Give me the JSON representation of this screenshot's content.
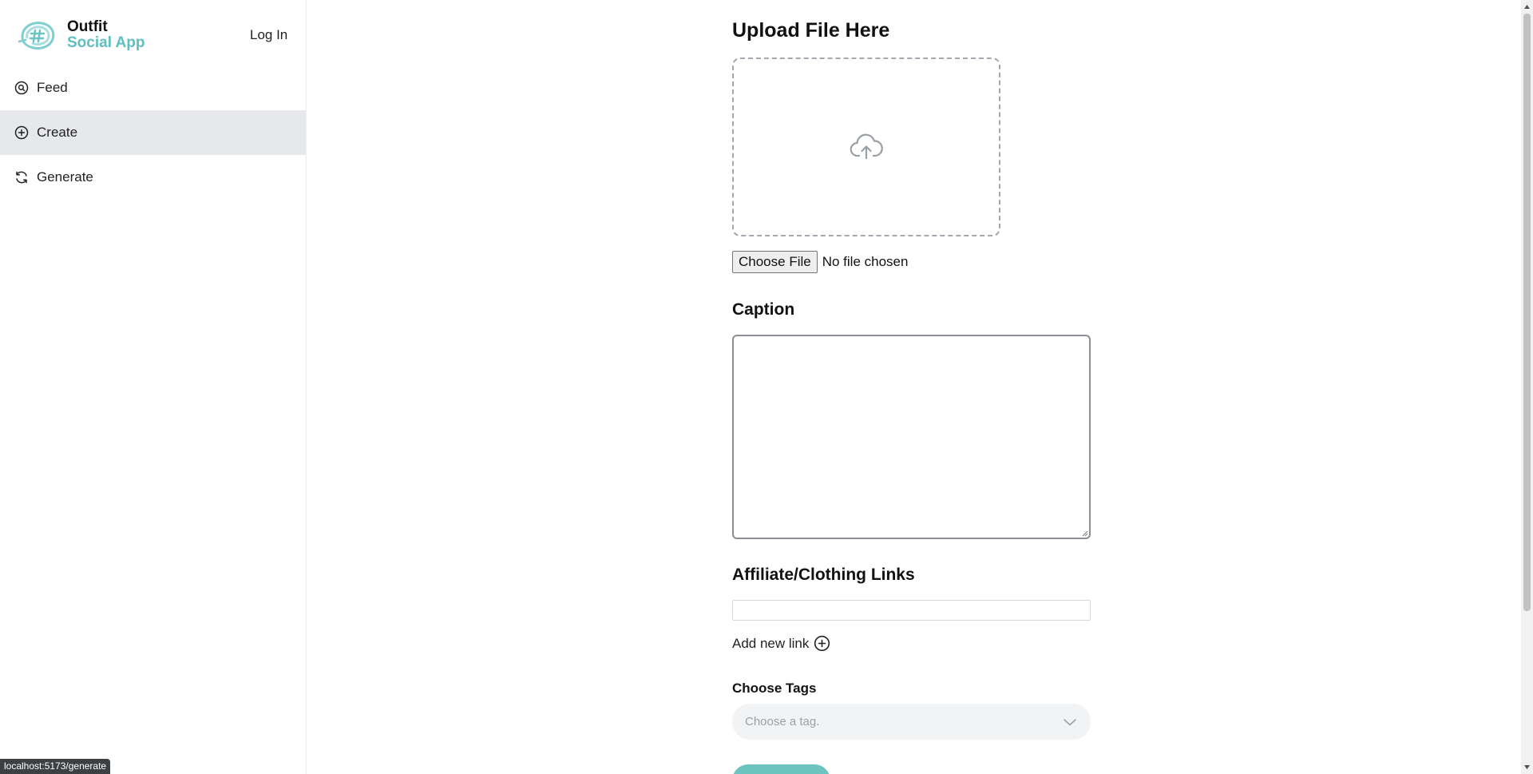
{
  "brand": {
    "line1": "Outfit",
    "line2": "Social App",
    "accent_color": "#5fbfc0"
  },
  "header": {
    "login_label": "Log In"
  },
  "sidebar": {
    "items": [
      {
        "label": "Feed",
        "icon": "search-circle-icon",
        "active": false
      },
      {
        "label": "Create",
        "icon": "plus-circle-icon",
        "active": true
      },
      {
        "label": "Generate",
        "icon": "refresh-icon",
        "active": false
      }
    ]
  },
  "upload": {
    "title": "Upload File Here",
    "icon": "cloud-upload-icon",
    "choose_button": "Choose File",
    "file_status": "No file chosen"
  },
  "caption": {
    "title": "Caption",
    "value": ""
  },
  "links": {
    "title": "Affiliate/Clothing Links",
    "value": "",
    "add_label": "Add new link",
    "add_icon": "plus-circle-icon"
  },
  "tags": {
    "title": "Choose Tags",
    "placeholder": "Choose a tag.",
    "icon": "chevron-down-icon"
  },
  "status_bar": {
    "url": "localhost:5173/generate"
  }
}
